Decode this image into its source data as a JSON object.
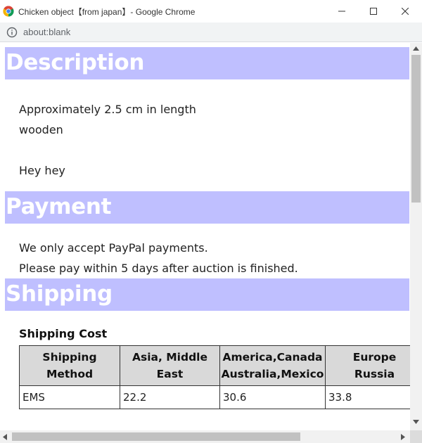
{
  "window": {
    "title": "Chicken object【from japan】- Google Chrome",
    "controls": [
      "minimize",
      "maximize",
      "close"
    ]
  },
  "address_bar": {
    "url": "about:blank",
    "icon": "info-icon"
  },
  "page": {
    "description": {
      "heading": "Description",
      "line1": "Approximately 2.5 cm in length",
      "line2": "wooden",
      "line3": "Hey hey"
    },
    "payment": {
      "heading": "Payment",
      "line1": "We only accept PayPal payments.",
      "line2": "Please pay within 5 days after auction is finished."
    },
    "shipping": {
      "heading": "Shipping",
      "cost_title": "Shipping Cost",
      "table": {
        "headers": [
          [
            "Shipping",
            "Method"
          ],
          [
            "Asia, Middle",
            "East"
          ],
          [
            "America,Canada",
            "Australia,Mexico"
          ],
          [
            "Europe",
            "Russia"
          ]
        ],
        "rows": [
          [
            "EMS",
            "22.2",
            "30.6",
            "33.8"
          ]
        ]
      }
    }
  },
  "colors": {
    "heading_bg": "#bfbfff",
    "heading_text": "#ffffff",
    "table_header_bg": "#d9d9d9"
  }
}
